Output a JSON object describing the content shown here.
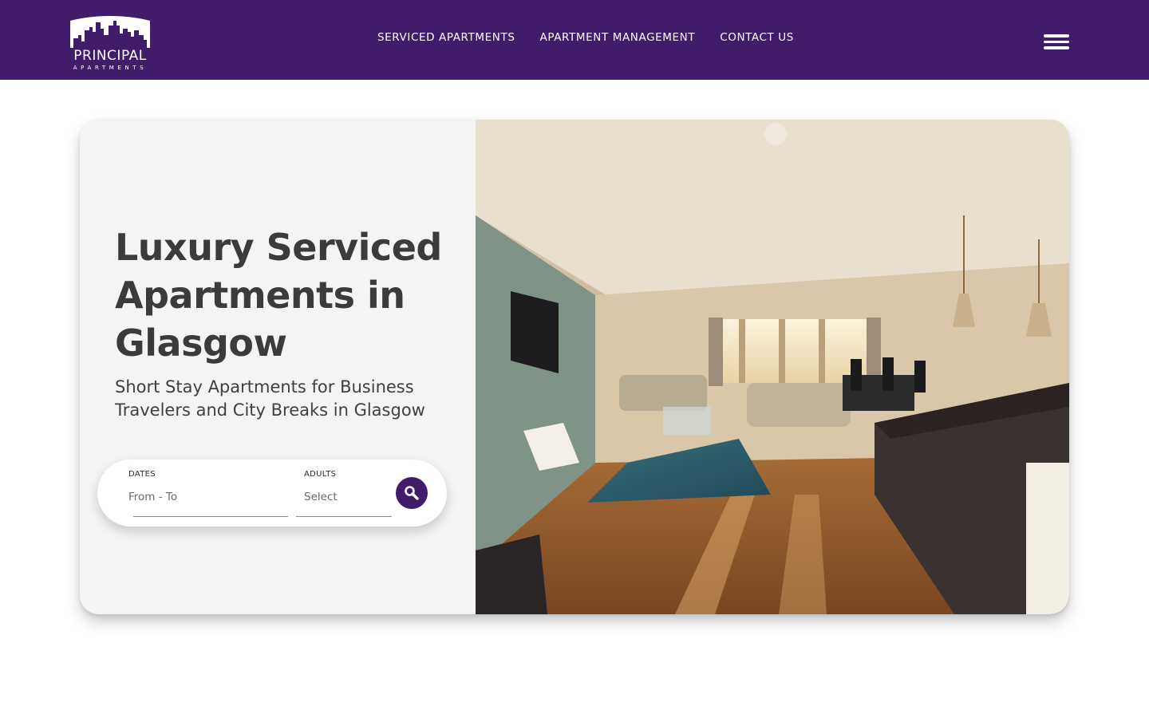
{
  "header": {
    "logo": {
      "word": "PRINCIPAL",
      "sub": "APARTMENTS"
    },
    "nav": [
      {
        "label": "SERVICED APARTMENTS"
      },
      {
        "label": "APARTMENT MANAGEMENT"
      },
      {
        "label": "CONTACT US"
      }
    ],
    "menu_icon": "hamburger-menu-icon",
    "background_color": "#411c6b"
  },
  "hero": {
    "title": "Luxury Serviced Apartments in Glasgow",
    "subtitle": "Short Stay Apartments for Business Travelers and City Breaks in Glasgow",
    "search": {
      "dates_label": "DATES",
      "dates_placeholder": "From - To",
      "adults_label": "ADULTS",
      "adults_placeholder": "Select",
      "button_icon": "search-icon"
    },
    "image_alt": "Open-plan serviced apartment living room with sofas, blue rug, dining table and kitchen island"
  }
}
